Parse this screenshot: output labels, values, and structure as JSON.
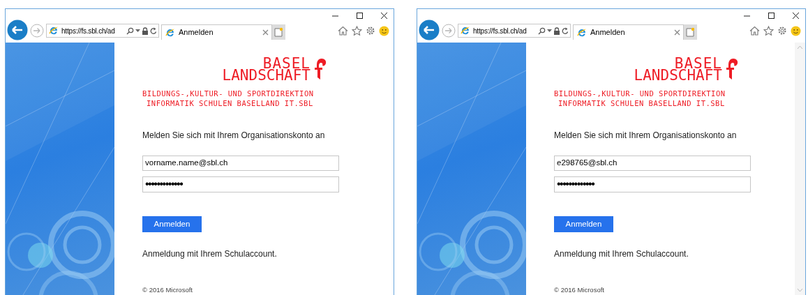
{
  "windows": [
    {
      "address": "https://fs.sbl.ch/ad",
      "tab_title": "Anmelden",
      "scrollbar": false,
      "logo": [
        "BASEL",
        "LANDSCHAFT"
      ],
      "department": [
        "BILDUNGS-,KULTUR- UND SPORTDIREKTION",
        "INFORMATIK SCHULEN BASELLAND IT.SBL"
      ],
      "prompt": "Melden Sie sich mit Ihrem Organisationskonto an",
      "username": "vorname.name@sbl.ch",
      "password": "•••••••••••••",
      "button": "Anmelden",
      "note": "Anmeldung mit Ihrem Schulaccount.",
      "copyright": "© 2016 Microsoft"
    },
    {
      "address": "https://fs.sbl.ch/ad",
      "tab_title": "Anmelden",
      "scrollbar": true,
      "logo": [
        "BASEL",
        "LANDSCHAFT"
      ],
      "department": [
        "BILDUNGS-,KULTUR- UND SPORTDIREKTION",
        "INFORMATIK SCHULEN BASELLAND IT.SBL"
      ],
      "prompt": "Melden Sie sich mit Ihrem Organisationskonto an",
      "username": "e298765@sbl.ch",
      "password": "•••••••••••••",
      "button": "Anmelden",
      "note": "Anmeldung mit Ihrem Schulaccount.",
      "copyright": "© 2016 Microsoft"
    }
  ]
}
